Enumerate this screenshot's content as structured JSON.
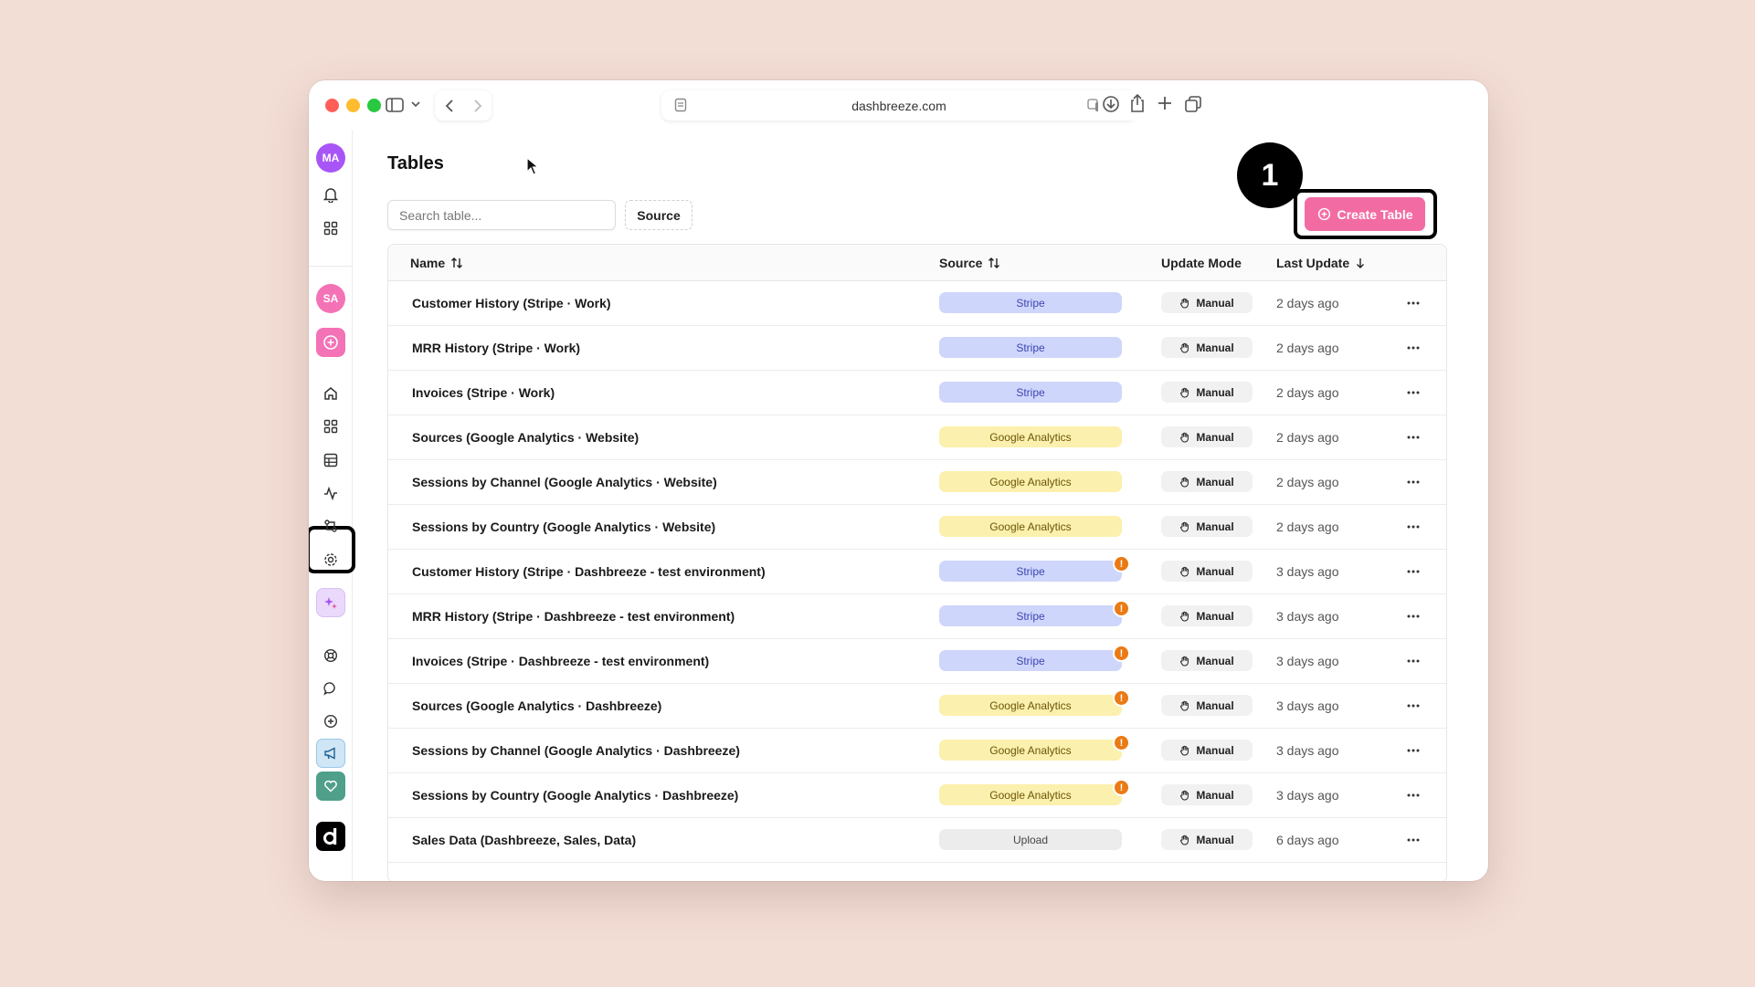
{
  "browser": {
    "url": "dashbreeze.com"
  },
  "sidebar": {
    "workspace_avatar": "MA",
    "user_avatar": "SA",
    "colors": {
      "workspace": "#a855f7",
      "user": "#f472b6",
      "add": "#f472b6"
    }
  },
  "page": {
    "title": "Tables",
    "search_placeholder": "Search table...",
    "source_filter_label": "Source",
    "create_button_label": "Create Table",
    "step_badge": "1"
  },
  "table": {
    "columns": {
      "name": "Name",
      "source": "Source",
      "mode": "Update Mode",
      "updated": "Last Update"
    },
    "rows": [
      {
        "name": "Customer History (Stripe · Work)",
        "source": "Stripe",
        "source_type": "stripe",
        "warning": false,
        "mode": "Manual",
        "updated": "2 days ago"
      },
      {
        "name": "MRR History (Stripe · Work)",
        "source": "Stripe",
        "source_type": "stripe",
        "warning": false,
        "mode": "Manual",
        "updated": "2 days ago"
      },
      {
        "name": "Invoices (Stripe · Work)",
        "source": "Stripe",
        "source_type": "stripe",
        "warning": false,
        "mode": "Manual",
        "updated": "2 days ago"
      },
      {
        "name": "Sources (Google Analytics · Website)",
        "source": "Google Analytics",
        "source_type": "ga",
        "warning": false,
        "mode": "Manual",
        "updated": "2 days ago"
      },
      {
        "name": "Sessions by Channel (Google Analytics · Website)",
        "source": "Google Analytics",
        "source_type": "ga",
        "warning": false,
        "mode": "Manual",
        "updated": "2 days ago"
      },
      {
        "name": "Sessions by Country (Google Analytics · Website)",
        "source": "Google Analytics",
        "source_type": "ga",
        "warning": false,
        "mode": "Manual",
        "updated": "2 days ago"
      },
      {
        "name": "Customer History (Stripe · Dashbreeze - test environment)",
        "source": "Stripe",
        "source_type": "stripe",
        "warning": true,
        "mode": "Manual",
        "updated": "3 days ago"
      },
      {
        "name": "MRR History (Stripe · Dashbreeze - test environment)",
        "source": "Stripe",
        "source_type": "stripe",
        "warning": true,
        "mode": "Manual",
        "updated": "3 days ago"
      },
      {
        "name": "Invoices (Stripe · Dashbreeze - test environment)",
        "source": "Stripe",
        "source_type": "stripe",
        "warning": true,
        "mode": "Manual",
        "updated": "3 days ago"
      },
      {
        "name": "Sources (Google Analytics · Dashbreeze)",
        "source": "Google Analytics",
        "source_type": "ga",
        "warning": true,
        "mode": "Manual",
        "updated": "3 days ago"
      },
      {
        "name": "Sessions by Channel (Google Analytics · Dashbreeze)",
        "source": "Google Analytics",
        "source_type": "ga",
        "warning": true,
        "mode": "Manual",
        "updated": "3 days ago"
      },
      {
        "name": "Sessions by Country (Google Analytics · Dashbreeze)",
        "source": "Google Analytics",
        "source_type": "ga",
        "warning": true,
        "mode": "Manual",
        "updated": "3 days ago"
      },
      {
        "name": "Sales Data (Dashbreeze, Sales, Data)",
        "source": "Upload",
        "source_type": "upload",
        "warning": false,
        "mode": "Manual",
        "updated": "6 days ago"
      }
    ]
  },
  "colors": {
    "accent": "#f26ca3",
    "stripe_pill": "#cfd6fb",
    "ga_pill": "#fbf0ad",
    "warning": "#ea7a14"
  }
}
